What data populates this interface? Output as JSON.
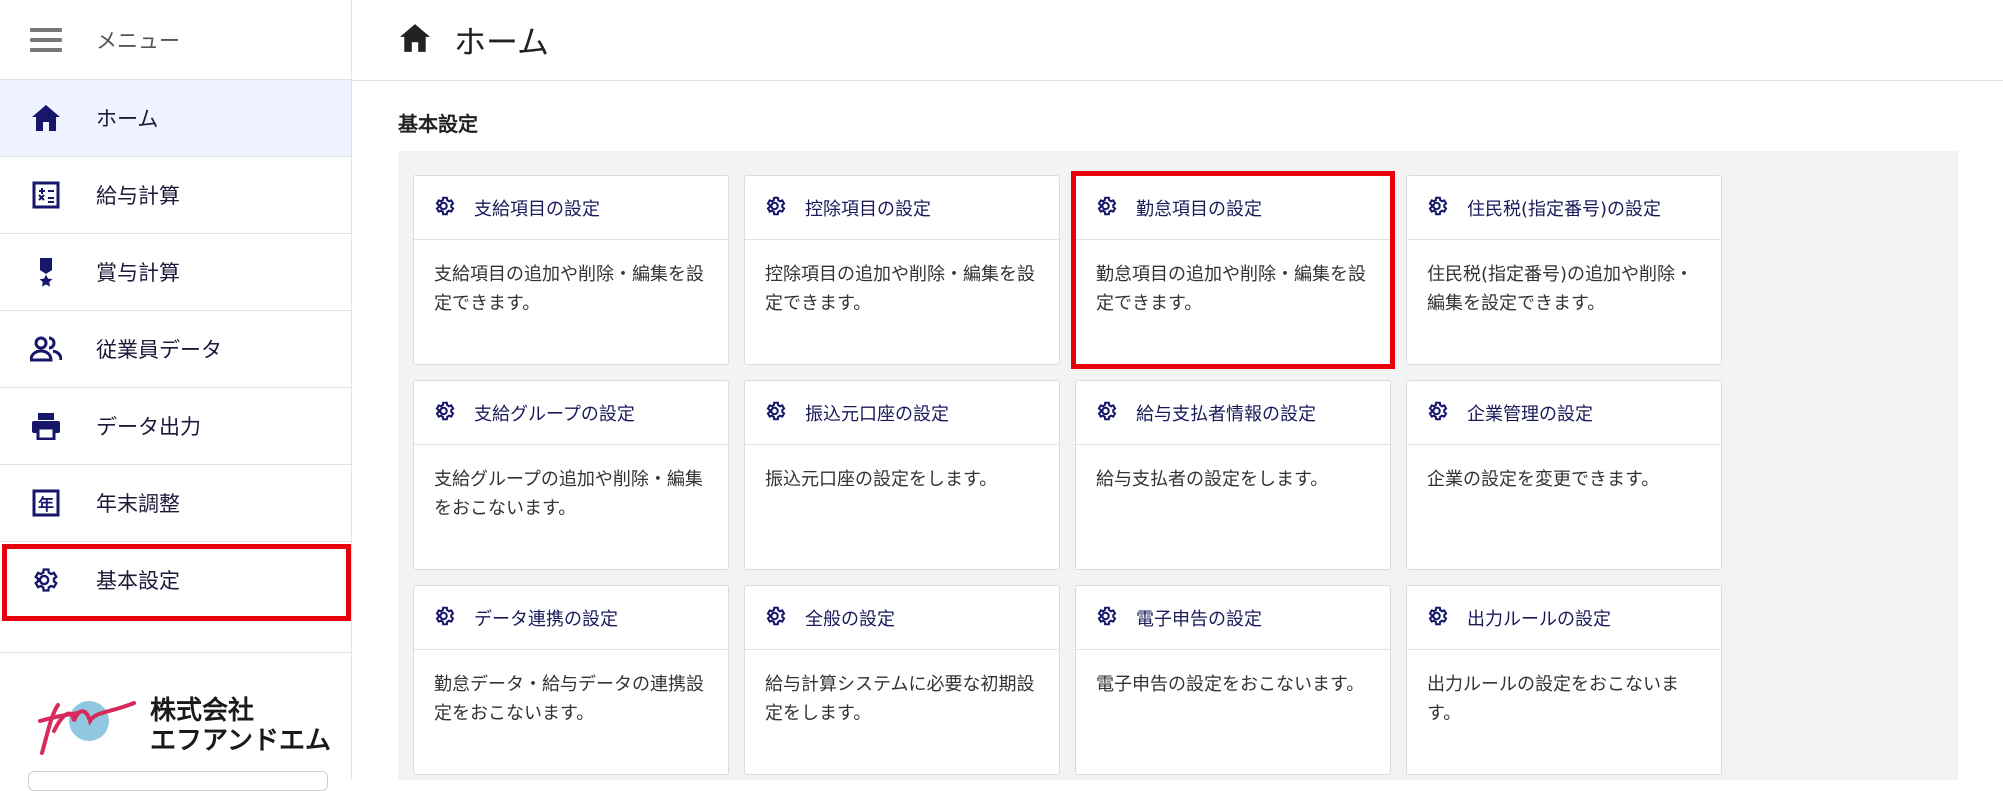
{
  "sidebar": {
    "menu_label": "メニュー",
    "items": [
      {
        "label": "ホーム",
        "icon": "home-icon"
      },
      {
        "label": "給与計算",
        "icon": "calculator-icon"
      },
      {
        "label": "賞与計算",
        "icon": "medal-icon"
      },
      {
        "label": "従業員データ",
        "icon": "people-icon"
      },
      {
        "label": "データ出力",
        "icon": "printer-icon"
      },
      {
        "label": "年末調整",
        "icon": "year-calendar-icon"
      },
      {
        "label": "基本設定",
        "icon": "gear-icon"
      }
    ],
    "logo_line1": "株式会社",
    "logo_line2": "エフアンドエム"
  },
  "header": {
    "title": "ホーム"
  },
  "section": {
    "title": "基本設定"
  },
  "cards": [
    {
      "title": "支給項目の設定",
      "desc": "支給項目の追加や削除・編集を設定できます。"
    },
    {
      "title": "控除項目の設定",
      "desc": "控除項目の追加や削除・編集を設定できます。"
    },
    {
      "title": "勤怠項目の設定",
      "desc": "勤怠項目の追加や削除・編集を設定できます。"
    },
    {
      "title": "住民税(指定番号)の設定",
      "desc": "住民税(指定番号)の追加や削除・編集を設定できます。"
    },
    {
      "title": "支給グループの設定",
      "desc": "支給グループの追加や削除・編集をおこないます。"
    },
    {
      "title": "振込元口座の設定",
      "desc": "振込元口座の設定をします。"
    },
    {
      "title": "給与支払者情報の設定",
      "desc": "給与支払者の設定をします。"
    },
    {
      "title": "企業管理の設定",
      "desc": "企業の設定を変更できます。"
    },
    {
      "title": "データ連携の設定",
      "desc": "勤怠データ・給与データの連携設定をおこないます。"
    },
    {
      "title": "全般の設定",
      "desc": "給与計算システムに必要な初期設定をします。"
    },
    {
      "title": "電子申告の設定",
      "desc": "電子申告の設定をおこないます。"
    },
    {
      "title": "出力ルールの設定",
      "desc": "出力ルールの設定をおこないます。"
    }
  ],
  "colors": {
    "accent": "#1a1a5a",
    "highlight": "#e8000b",
    "active_bg": "#eef3ff"
  }
}
